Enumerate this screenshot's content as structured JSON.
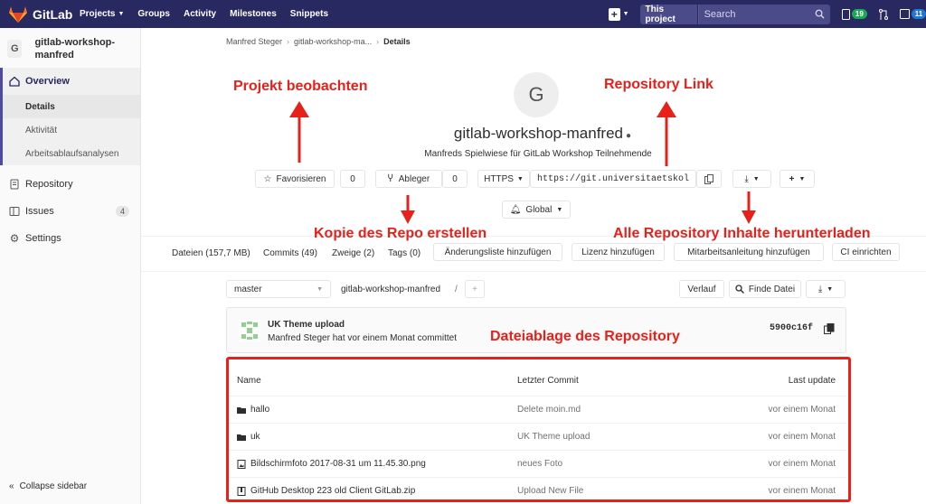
{
  "nav": {
    "brand": "GitLab",
    "links": [
      "Projects",
      "Groups",
      "Activity",
      "Milestones",
      "Snippets"
    ],
    "this_project": "This project",
    "search_placeholder": "Search",
    "todos_count": "19",
    "issues_badge": "11"
  },
  "sidebar": {
    "project_initial": "G",
    "project_name": "gitlab-workshop-manfred",
    "items": {
      "overview": "Overview",
      "details": "Details",
      "activity": "Aktivität",
      "cycle": "Arbeitsablaufsanalysen",
      "repository": "Repository",
      "issues": "Issues",
      "issues_count": "4",
      "settings": "Settings"
    },
    "collapse": "Collapse sidebar"
  },
  "breadcrumb": [
    "Manfred Steger",
    "gitlab-workshop-ma...",
    "Details"
  ],
  "project": {
    "initial": "G",
    "title": "gitlab-workshop-manfred",
    "description": "Manfreds Spielwiese für GitLab Workshop Teilnehmende",
    "star_label": "Favorisieren",
    "star_count": "0",
    "fork_label": "Ableger",
    "fork_count": "0",
    "protocol": "HTTPS",
    "clone_url": "https://git.universitaetskol",
    "notification": "Global"
  },
  "stats": {
    "files": "Dateien (157,7 MB)",
    "commits": "Commits (49)",
    "branches": "Zweige (2)",
    "tags": "Tags (0)",
    "add_changelog": "Änderungsliste hinzufügen",
    "add_license": "Lizenz hinzufügen",
    "add_contrib": "Mitarbeitsanleitung hinzufügen",
    "setup_ci": "CI einrichten"
  },
  "tree": {
    "branch": "master",
    "path": "gitlab-workshop-manfred",
    "path_sep": "/",
    "history": "Verlauf",
    "find_file": "Finde Datei"
  },
  "commit": {
    "title": "UK Theme upload",
    "meta": "Manfred Steger hat vor einem Monat committet",
    "sha": "5900c16f"
  },
  "files": {
    "headers": {
      "name": "Name",
      "commit": "Letzter Commit",
      "update": "Last update"
    },
    "rows": [
      {
        "name": "hallo",
        "type": "folder",
        "commit": "Delete moin.md",
        "update": "vor einem Monat"
      },
      {
        "name": "uk",
        "type": "folder",
        "commit": "UK Theme upload",
        "update": "vor einem Monat"
      },
      {
        "name": "Bildschirmfoto 2017-08-31 um 11.45.30.png",
        "type": "image",
        "commit": "neues Foto",
        "update": "vor einem Monat"
      },
      {
        "name": "GitHub Desktop 223 old Client GitLab.zip",
        "type": "archive",
        "commit": "Upload New File",
        "update": "vor einem Monat"
      }
    ]
  },
  "annotations": {
    "watch": "Projekt beobachten",
    "repo_link": "Repository Link",
    "fork": "Kopie des Repo erstellen",
    "download": "Alle Repository Inhalte herunterladen",
    "storage": "Dateiablage des Repository"
  },
  "colors": {
    "nav": "#292961",
    "annotation": "#e8201a",
    "accent": "#4b4ba3"
  }
}
